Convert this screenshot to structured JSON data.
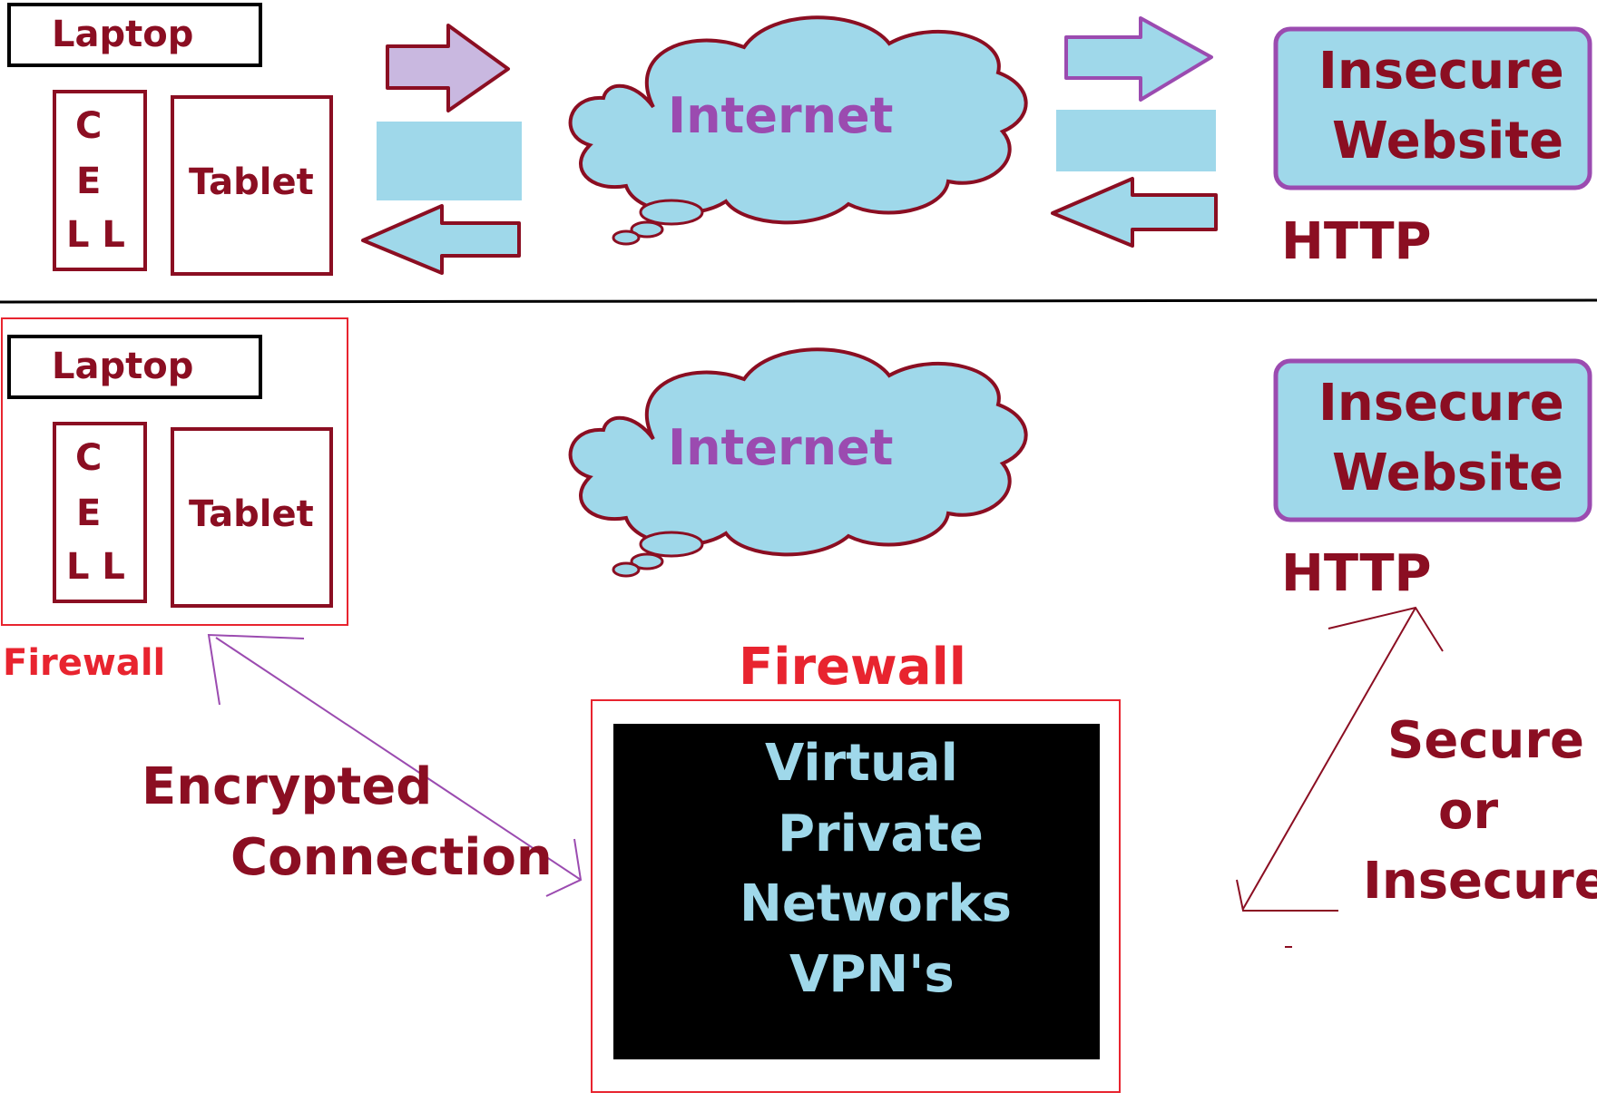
{
  "colors": {
    "maroon": "#8b0e22",
    "purple": "#9b4bb0",
    "light_blue": "#9fd8ea",
    "red": "#e8242f",
    "arrow_lavender": "#c9b8e0",
    "black": "#000000"
  },
  "top": {
    "laptop": "Laptop",
    "cell_letters": [
      "C",
      "E",
      "L L"
    ],
    "tablet": "Tablet",
    "internet": "Internet",
    "website_line1": "Insecure",
    "website_line2": "Website",
    "protocol": "HTTP"
  },
  "bottom": {
    "laptop": "Laptop",
    "cell_letters": [
      "C",
      "E",
      "L L"
    ],
    "tablet": "Tablet",
    "device_firewall": "Firewall",
    "internet": "Internet",
    "website_line1": "Insecure",
    "website_line2": "Website",
    "protocol": "HTTP",
    "encrypted_line1": "Encrypted",
    "encrypted_line2": "Connection",
    "vpn_firewall": "Firewall",
    "vpn_lines": [
      "Virtual",
      "Private",
      "Networks",
      "VPN's"
    ],
    "secure_lines": [
      "Secure",
      "or",
      "Insecure"
    ]
  }
}
